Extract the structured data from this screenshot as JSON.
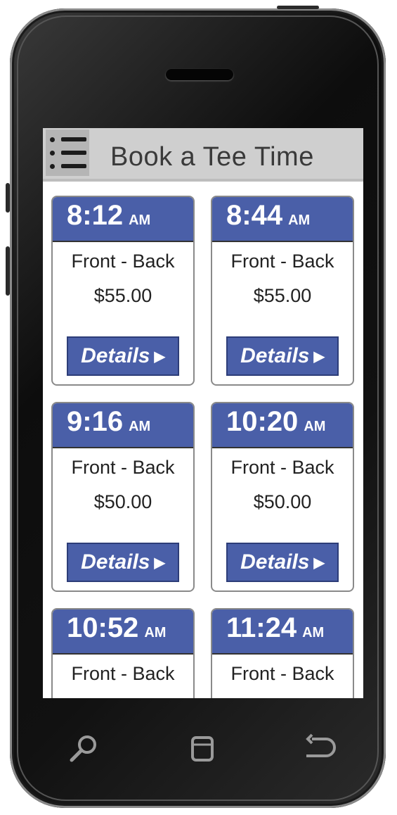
{
  "header": {
    "title": "Book a Tee Time"
  },
  "tee_times": [
    {
      "time": "8:12",
      "ampm": "AM",
      "course": "Front - Back",
      "price": "$55.00",
      "details_label": "Details"
    },
    {
      "time": "8:44",
      "ampm": "AM",
      "course": "Front - Back",
      "price": "$55.00",
      "details_label": "Details"
    },
    {
      "time": "9:16",
      "ampm": "AM",
      "course": "Front - Back",
      "price": "$50.00",
      "details_label": "Details"
    },
    {
      "time": "10:20",
      "ampm": "AM",
      "course": "Front - Back",
      "price": "$50.00",
      "details_label": "Details"
    },
    {
      "time": "10:52",
      "ampm": "AM",
      "course": "Front - Back",
      "price": "",
      "details_label": ""
    },
    {
      "time": "11:24",
      "ampm": "AM",
      "course": "Front - Back",
      "price": "",
      "details_label": ""
    }
  ],
  "icons": {
    "menu": "hamburger-menu-icon",
    "details_arrow": "play-arrow-icon",
    "nav_search": "search-icon",
    "nav_home": "home-icon",
    "nav_back": "back-icon"
  },
  "colors": {
    "accent_blue": "#4a5fa8",
    "app_bar": "#cfcfcf",
    "menu_button": "#b5b5b5"
  }
}
